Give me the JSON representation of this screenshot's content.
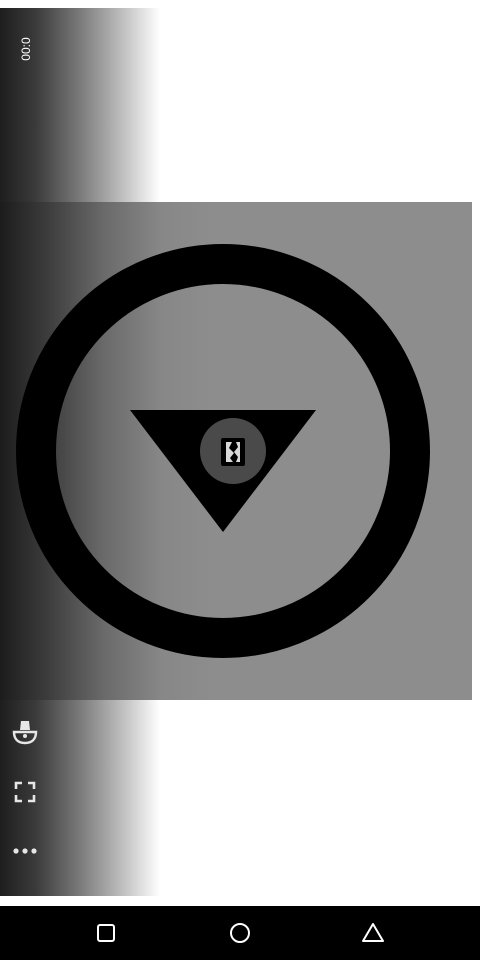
{
  "player": {
    "elapsed_time": "00:0",
    "icons": {
      "lamp": "lamp-icon",
      "fullscreen": "fullscreen-icon",
      "more": "more-options-icon"
    },
    "center_button_icon": "torn-page-icon"
  },
  "navigation": {
    "recents": "square-recents-icon",
    "home": "circle-home-icon",
    "back": "triangle-back-icon"
  },
  "colors": {
    "nav_bar": "#000000",
    "video_background": "#8d8d8d",
    "ring": "#000000",
    "center_button": "#4a4a4a",
    "icon_light": "#e6e6e6"
  }
}
